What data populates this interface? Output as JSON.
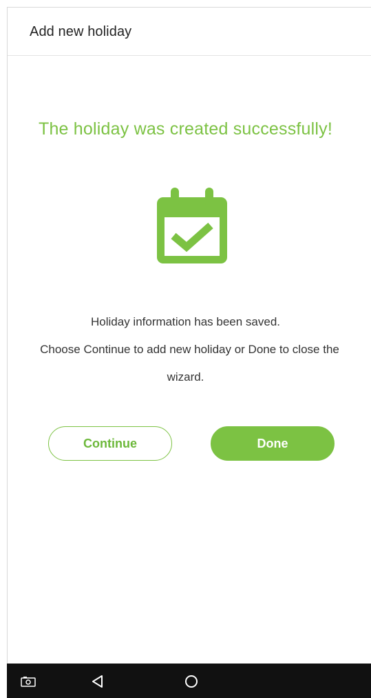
{
  "header": {
    "title": "Add new holiday"
  },
  "main": {
    "success_title": "The holiday was created successfully!",
    "icon": "calendar-check-icon",
    "info_line_1": "Holiday information has been saved.",
    "info_line_2": "Choose Continue to add new holiday or Done to close the",
    "info_line_3": "wizard."
  },
  "buttons": {
    "continue_label": "Continue",
    "done_label": "Done"
  },
  "navbar": {
    "items": [
      "screenshot-icon",
      "back-icon",
      "home-icon"
    ]
  },
  "colors": {
    "accent": "#7cc243",
    "navbar_bg": "#111111"
  }
}
